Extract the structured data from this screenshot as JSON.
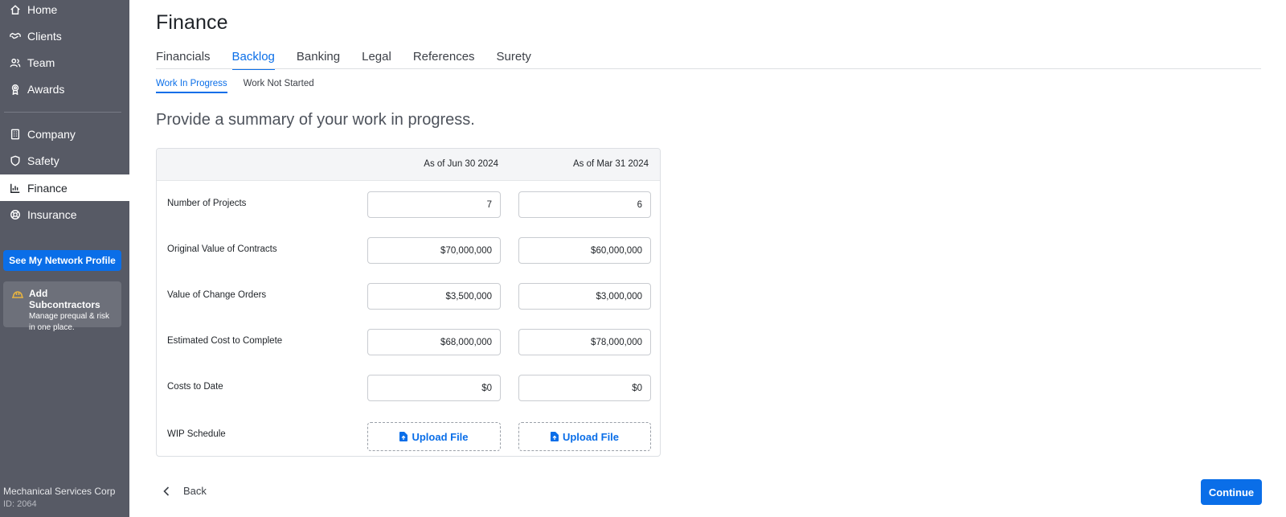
{
  "sidebar": {
    "items": [
      {
        "label": "Home",
        "icon": "home-icon"
      },
      {
        "label": "Clients",
        "icon": "handshake-icon"
      },
      {
        "label": "Team",
        "icon": "users-icon"
      },
      {
        "label": "Awards",
        "icon": "award-icon"
      },
      {
        "label": "Company",
        "icon": "building-icon"
      },
      {
        "label": "Safety",
        "icon": "shield-icon"
      },
      {
        "label": "Finance",
        "icon": "chart-icon",
        "active": true
      },
      {
        "label": "Insurance",
        "icon": "lifebuoy-icon"
      }
    ],
    "network_button": "See My Network Profile",
    "promo": {
      "title": "Add Subcontractors",
      "line1": "Manage prequal & risk",
      "line2": "in one place.",
      "icon": "hardhat-icon"
    },
    "company_name": "Mechanical Services Corp",
    "company_id": "ID: 2064"
  },
  "page": {
    "title": "Finance",
    "tabs": [
      "Financials",
      "Backlog",
      "Banking",
      "Legal",
      "References",
      "Surety"
    ],
    "active_tab": "Backlog",
    "subtabs": [
      "Work In Progress",
      "Work Not Started"
    ],
    "active_subtab": "Work In Progress",
    "heading": "Provide a summary of your work in progress."
  },
  "table": {
    "columns": [
      "As of Jun 30 2024",
      "As of Mar 31 2024"
    ],
    "rows": [
      {
        "label": "Number of Projects",
        "values": [
          "7",
          "6"
        ]
      },
      {
        "label": "Original Value of Contracts",
        "values": [
          "$70,000,000",
          "$60,000,000"
        ]
      },
      {
        "label": "Value of Change Orders",
        "values": [
          "$3,500,000",
          "$3,000,000"
        ]
      },
      {
        "label": "Estimated Cost to Complete",
        "values": [
          "$68,000,000",
          "$78,000,000"
        ]
      },
      {
        "label": "Costs to Date",
        "values": [
          "$0",
          "$0"
        ]
      }
    ],
    "upload_row": {
      "label": "WIP Schedule",
      "button": "Upload File"
    }
  },
  "footer": {
    "back_label": "Back",
    "continue_label": "Continue"
  },
  "colors": {
    "sidebar_bg": "#575a65",
    "accent": "#0a6ee8",
    "promo_icon": "#e6b341"
  }
}
